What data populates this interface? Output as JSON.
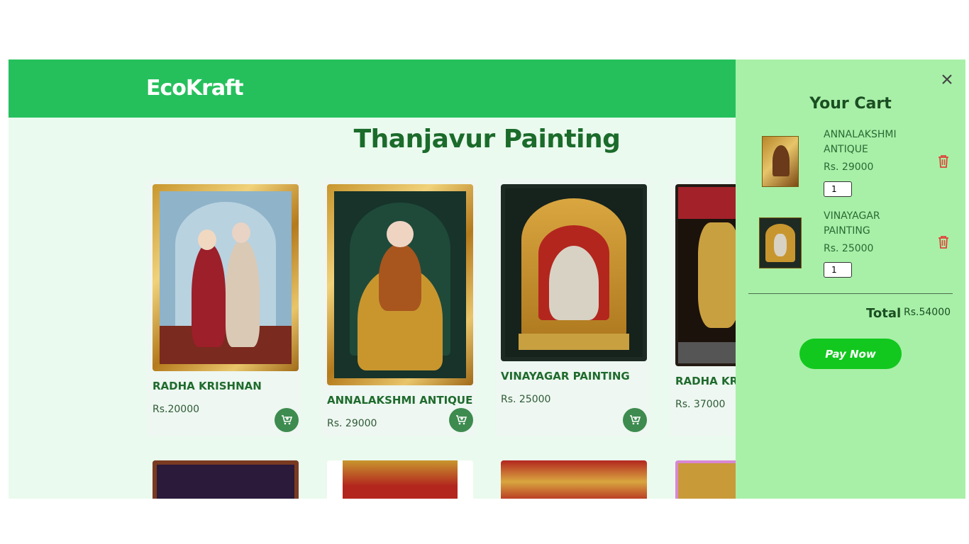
{
  "header": {
    "logo": "EcoKraft"
  },
  "page": {
    "title": "Thanjavur Painting"
  },
  "products": [
    {
      "name": "RADHA KRISHNAN",
      "price": "Rs.20000"
    },
    {
      "name": "ANNALAKSHMI ANTIQUE",
      "price": "Rs. 29000"
    },
    {
      "name": "VINAYAGAR PAINTING",
      "price": "Rs. 25000"
    },
    {
      "name": "RADHA KRISHNAN",
      "price": "Rs. 37000"
    }
  ],
  "cart": {
    "title": "Your Cart",
    "close_icon": "×",
    "items": [
      {
        "name": "ANNALAKSHMI ANTIQUE",
        "price": "Rs. 29000",
        "qty": "1"
      },
      {
        "name": "VINAYAGAR PAINTING",
        "price": "Rs. 25000",
        "qty": "1"
      }
    ],
    "total_label": "Total",
    "total_value": "Rs.54000",
    "pay_label": "Pay Now"
  },
  "colors": {
    "header": "#25c05c",
    "cart_bg": "#a8f0a8",
    "pay": "#12c81e",
    "cart_btn": "#3d8b4f",
    "trash": "#e0443a"
  },
  "icons": {
    "add_to_cart": "cart-plus-icon",
    "remove": "trash-icon",
    "close": "close-icon"
  }
}
